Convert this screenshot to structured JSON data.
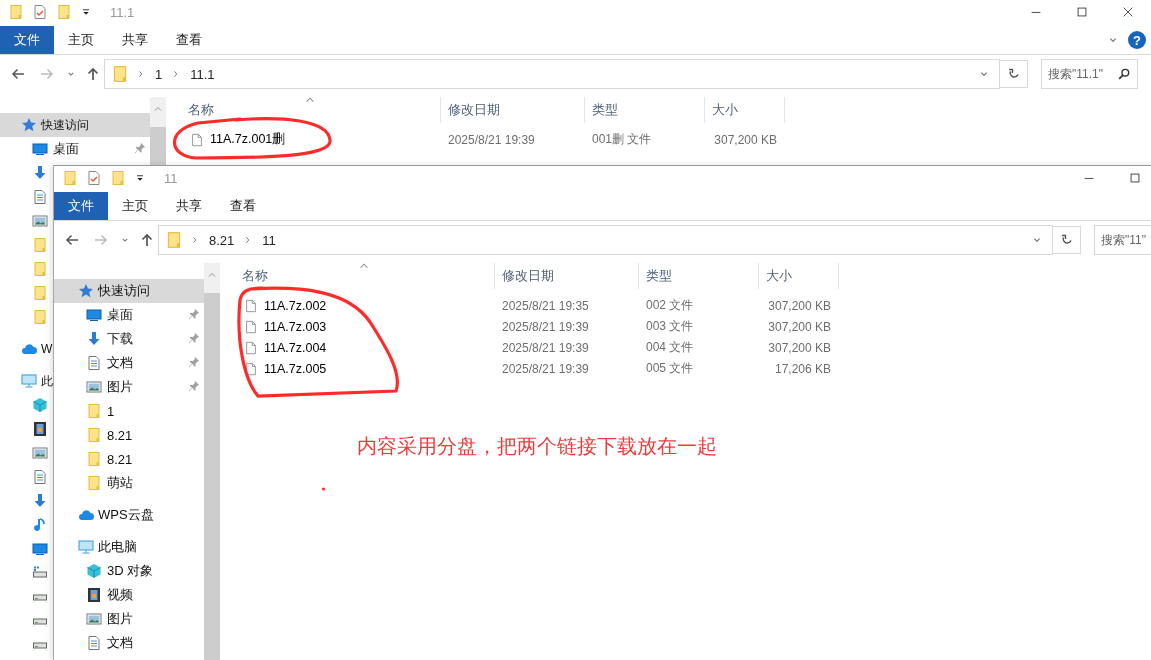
{
  "windows": [
    {
      "title": "11.1",
      "controls": [
        {
          "kind": "minimize"
        },
        {
          "kind": "maximize"
        },
        {
          "kind": "close"
        }
      ],
      "help": "?",
      "ribbon_tabs": [
        {
          "label": "文件",
          "selected": true
        },
        {
          "label": "主页",
          "selected": false
        },
        {
          "label": "共享",
          "selected": false
        },
        {
          "label": "查看",
          "selected": false
        }
      ],
      "path": [
        "1",
        "11.1"
      ],
      "search": {
        "placeholder": "搜索\"11.1\"",
        "button": true
      },
      "nav": [
        {
          "kind": "star",
          "label": "快速访问",
          "selected": true,
          "children": [
            {
              "kind": "monitor",
              "label": "桌面",
              "selected": false,
              "pinned": true
            },
            {
              "kind": "download",
              "selected": false
            },
            {
              "kind": "document",
              "selected": false
            },
            {
              "kind": "image",
              "selected": false
            },
            {
              "kind": "folder",
              "selected": false
            },
            {
              "kind": "folder",
              "selected": false
            },
            {
              "kind": "folder",
              "selected": false
            },
            {
              "kind": "folder",
              "selected": false
            }
          ]
        },
        {
          "kind": "cloud",
          "label": "W",
          "selected": false
        },
        {
          "kind": "computer",
          "label": "此",
          "selected": false,
          "children": [
            {
              "kind": "cube",
              "selected": false
            },
            {
              "kind": "film",
              "selected": false
            },
            {
              "kind": "image",
              "selected": false
            },
            {
              "kind": "document",
              "selected": false
            },
            {
              "kind": "download",
              "selected": false
            },
            {
              "kind": "music",
              "selected": false
            },
            {
              "kind": "monitor",
              "selected": false
            },
            {
              "kind": "netdrive",
              "selected": false
            },
            {
              "kind": "drive",
              "selected": false
            },
            {
              "kind": "drive",
              "selected": false
            },
            {
              "kind": "drive",
              "selected": false
            }
          ]
        }
      ],
      "columns": [
        "名称",
        "修改日期",
        "类型",
        "大小"
      ],
      "rows": [
        {
          "name": "11A.7z.001删",
          "modified": "2025/8/21 19:39",
          "type": "001删 文件",
          "size": "307,200 KB"
        }
      ]
    },
    {
      "title": "11",
      "controls": [
        {
          "kind": "minimize"
        },
        {
          "kind": "maximize"
        }
      ],
      "ribbon_tabs": [
        {
          "label": "文件",
          "selected": true
        },
        {
          "label": "主页",
          "selected": false
        },
        {
          "label": "共享",
          "selected": false
        },
        {
          "label": "查看",
          "selected": false
        }
      ],
      "path": [
        "8.21",
        "11"
      ],
      "search": {
        "placeholder": "搜索\"11\""
      },
      "nav": [
        {
          "kind": "star",
          "label": "快速访问",
          "selected": true,
          "children": [
            {
              "kind": "monitor",
              "label": "桌面",
              "selected": false,
              "pinned": true
            },
            {
              "kind": "download",
              "label": "下载",
              "selected": false,
              "pinned": true
            },
            {
              "kind": "document",
              "label": "文档",
              "selected": false,
              "pinned": true
            },
            {
              "kind": "image",
              "label": "图片",
              "selected": false,
              "pinned": true
            },
            {
              "kind": "folder",
              "label": "1",
              "selected": false,
              "pinned": false
            },
            {
              "kind": "folder",
              "label": "8.21",
              "selected": false,
              "pinned": false
            },
            {
              "kind": "folder",
              "label": "8.21",
              "selected": false,
              "pinned": false
            },
            {
              "kind": "folder",
              "label": "萌站",
              "selected": false,
              "pinned": false
            }
          ]
        },
        {
          "kind": "cloud",
          "label": "WPS云盘",
          "selected": false
        },
        {
          "kind": "computer",
          "label": "此电脑",
          "selected": false,
          "children": [
            {
              "kind": "cube",
              "label": "3D 对象",
              "selected": false
            },
            {
              "kind": "film",
              "label": "视频",
              "selected": false
            },
            {
              "kind": "image",
              "label": "图片",
              "selected": false
            },
            {
              "kind": "document",
              "label": "文档",
              "selected": false
            }
          ]
        }
      ],
      "columns": [
        "名称",
        "修改日期",
        "类型",
        "大小"
      ],
      "rows": [
        {
          "name": "11A.7z.002",
          "modified": "2025/8/21 19:35",
          "type": "002 文件",
          "size": "307,200 KB"
        },
        {
          "name": "11A.7z.003",
          "modified": "2025/8/21 19:39",
          "type": "003 文件",
          "size": "307,200 KB"
        },
        {
          "name": "11A.7z.004",
          "modified": "2025/8/21 19:39",
          "type": "004 文件",
          "size": "307,200 KB"
        },
        {
          "name": "11A.7z.005",
          "modified": "2025/8/21 19:39",
          "type": "005 文件",
          "size": "17,206 KB"
        }
      ]
    }
  ],
  "annotations": [
    {
      "kind": "circle"
    },
    {
      "kind": "circle"
    },
    {
      "kind": "note",
      "text": "内容采用分盘，把两个链接下载放在一起"
    },
    {
      "kind": "dot"
    }
  ]
}
